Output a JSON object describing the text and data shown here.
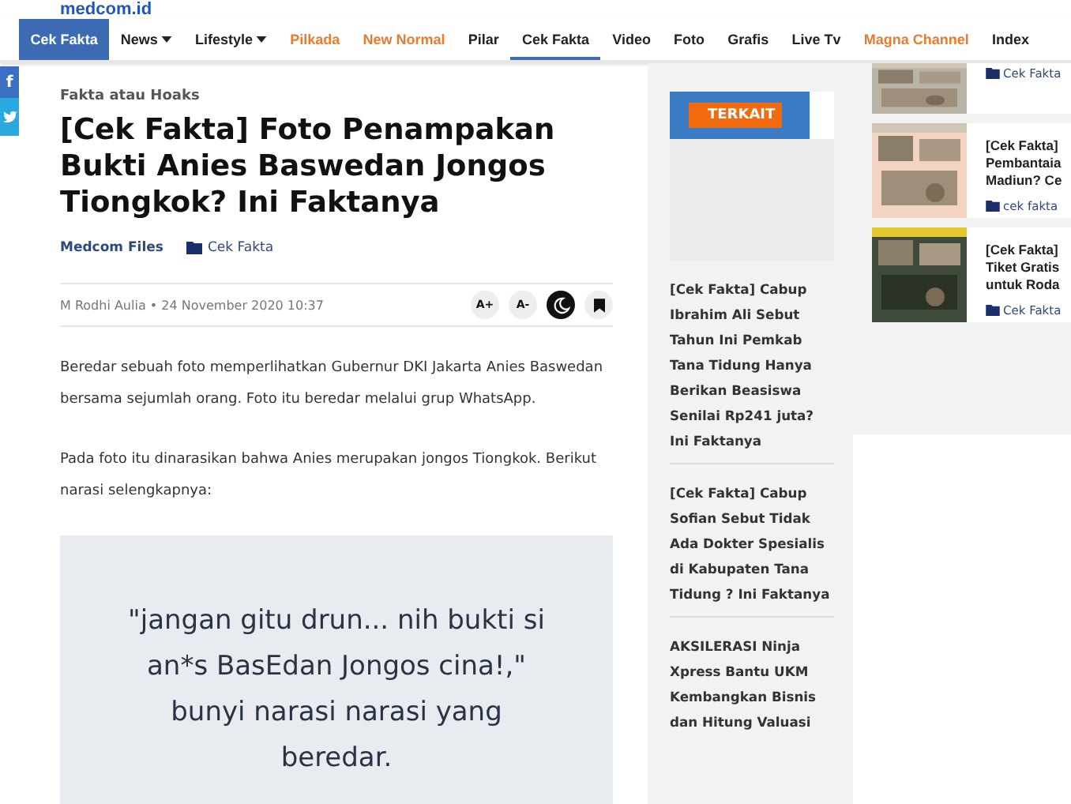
{
  "logo": "medcom.id",
  "nav": [
    {
      "label": "Cek Fakta",
      "kind": "brand",
      "selected": false,
      "caret": false
    },
    {
      "label": "News",
      "kind": "link",
      "selected": false,
      "caret": true
    },
    {
      "label": "Lifestyle",
      "kind": "link",
      "selected": false,
      "caret": true
    },
    {
      "label": "Pilkada",
      "kind": "promo",
      "selected": false,
      "caret": false
    },
    {
      "label": "New Normal",
      "kind": "promo",
      "selected": false,
      "caret": false
    },
    {
      "label": "Pilar",
      "kind": "link",
      "selected": false,
      "caret": false
    },
    {
      "label": "Cek Fakta",
      "kind": "link",
      "selected": true,
      "caret": false
    },
    {
      "label": "Video",
      "kind": "link",
      "selected": false,
      "caret": false
    },
    {
      "label": "Foto",
      "kind": "link",
      "selected": false,
      "caret": false
    },
    {
      "label": "Grafis",
      "kind": "link",
      "selected": false,
      "caret": false
    },
    {
      "label": "Live Tv",
      "kind": "link",
      "selected": false,
      "caret": false
    },
    {
      "label": "Magna Channel",
      "kind": "promo",
      "selected": false,
      "caret": false
    },
    {
      "label": "Index",
      "kind": "link",
      "selected": false,
      "caret": false
    }
  ],
  "share": [
    {
      "label": "f",
      "kind": "facebook"
    },
    {
      "kind": "twitter"
    }
  ],
  "article": {
    "kicker": "Fakta atau Hoaks",
    "title": "[Cek Fakta] Foto Penampakan Bukti Anies Baswedan Jongos Tiongkok? Ini Faktanya",
    "source": "Medcom Files",
    "category": "Cek Fakta",
    "byline": "M Rodhi Aulia • 24 November 2020 10:37",
    "tools": [
      {
        "label": "A+",
        "kind": "text"
      },
      {
        "label": "A-",
        "kind": "text"
      },
      {
        "kind": "moon"
      },
      {
        "kind": "bookmark"
      }
    ],
    "paragraphs": [
      "Beredar sebuah foto memperlihatkan Gubernur DKI Jakarta Anies Baswedan bersama sejumlah orang. Foto itu beredar melalui grup WhatsApp.",
      "Pada foto itu dinarasikan bahwa Anies merupakan jongos Tiongkok. Berikut narasi selengkapnya:"
    ],
    "quote": "\"jangan gitu drun... nih bukti si an*s BasEdan Jongos cina!,\" bunyi narasi narasi yang beredar."
  },
  "related": {
    "label": "TERKAIT",
    "links": [
      "[Cek Fakta] Cabup Ibrahim Ali Sebut Tahun Ini Pemkab Tana Tidung Hanya Berikan Beasiswa Senilai Rp241 juta? Ini Faktanya",
      "[Cek Fakta] Cabup Sofian Sebut Tidak Ada Dokter Spesialis di Kabupaten Tana Tidung ? Ini Faktanya",
      "AKSILERASI Ninja Xpress Bantu UKM Kembangkan Bisnis dan Hitung Valuasi"
    ]
  },
  "side_news": [
    {
      "category": "Cek Fakta"
    },
    {
      "lines": [
        "[Cek Fakta]",
        "Pembantaia",
        "Madiun? Ce"
      ],
      "category": "cek fakta"
    },
    {
      "lines": [
        "[Cek Fakta]",
        "Tiket Gratis",
        "untuk Roda"
      ],
      "category": "Cek Fakta"
    }
  ]
}
